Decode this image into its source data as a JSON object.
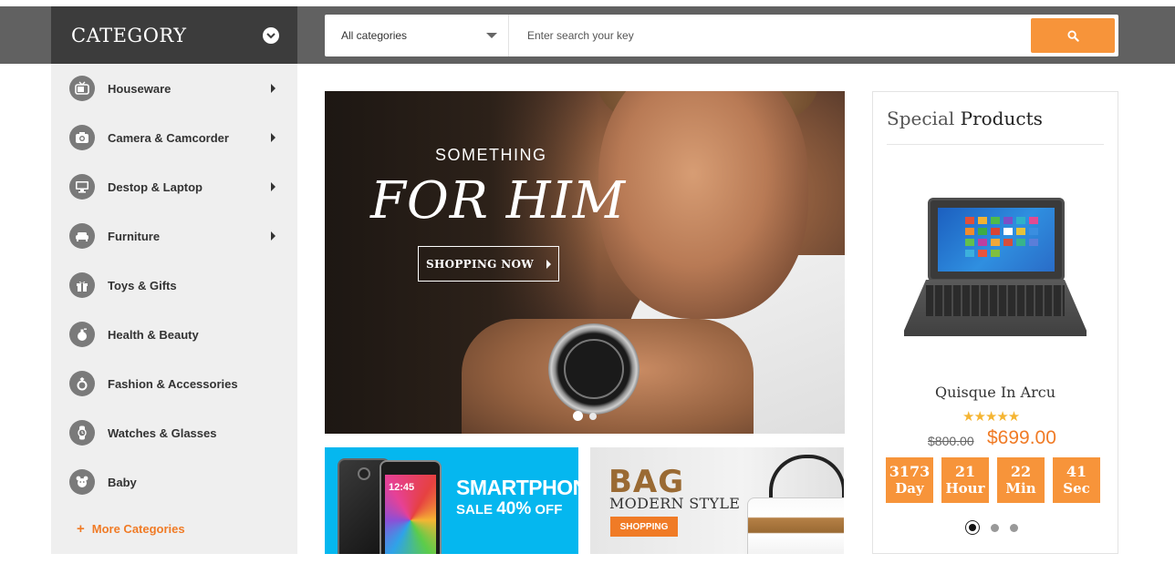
{
  "category_menu": {
    "title": "CATEGORY",
    "items": [
      {
        "label": "Houseware",
        "icon": "tv-icon",
        "has_submenu": true
      },
      {
        "label": "Camera & Camcorder",
        "icon": "camera-icon",
        "has_submenu": true
      },
      {
        "label": "Destop & Laptop",
        "icon": "monitor-icon",
        "has_submenu": true
      },
      {
        "label": "Furniture",
        "icon": "sofa-icon",
        "has_submenu": true
      },
      {
        "label": "Toys & Gifts",
        "icon": "gift-icon",
        "has_submenu": false
      },
      {
        "label": "Health & Beauty",
        "icon": "perfume-icon",
        "has_submenu": false
      },
      {
        "label": "Fashion & Accessories",
        "icon": "ring-icon",
        "has_submenu": false
      },
      {
        "label": "Watches & Glasses",
        "icon": "watch-icon",
        "has_submenu": false
      },
      {
        "label": "Baby",
        "icon": "teddy-bear-icon",
        "has_submenu": false
      }
    ],
    "more_label": "More Categories"
  },
  "search": {
    "category_select": "All categories",
    "placeholder": "Enter search your key"
  },
  "hero": {
    "subtitle": "SOMETHING",
    "title": "FOR HIM",
    "button_label": "SHOPPING NOW",
    "slides": 2,
    "active_slide": 1
  },
  "promo_phone": {
    "title": "SMARTPHONE",
    "sale_prefix": "SALE ",
    "sale_amount": "40%",
    "sale_suffix": " OFF",
    "phone_time": "12:45"
  },
  "promo_bag": {
    "title": "BAG",
    "subtitle": "MODERN STYLE",
    "button_label": "SHOPPING"
  },
  "special_products": {
    "title_light": "Special ",
    "title_bold": "Products",
    "product": {
      "name": "Quisque In Arcu",
      "rating": 5,
      "stars": "★★★★★",
      "old_price": "$800.00",
      "new_price": "$699.00"
    },
    "countdown": [
      {
        "value": "3173",
        "unit": "Day"
      },
      {
        "value": "21",
        "unit": "Hour"
      },
      {
        "value": "22",
        "unit": "Min"
      },
      {
        "value": "41",
        "unit": "Sec"
      }
    ],
    "pager_count": 3,
    "pager_active": 1
  },
  "colors": {
    "accent": "#f7943a",
    "top_bar": "#616161",
    "category_header": "#3c3c3c",
    "promo_blue": "#05b7ef"
  }
}
